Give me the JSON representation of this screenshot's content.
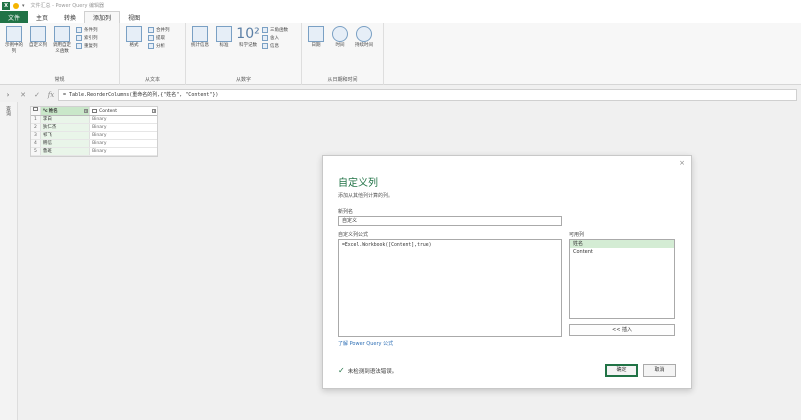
{
  "window": {
    "app_logo": "X",
    "title": "文件汇总 - Power Query 编辑器"
  },
  "ribbon_tabs": [
    {
      "label": "文件"
    },
    {
      "label": "主页"
    },
    {
      "label": "转换"
    },
    {
      "label": "添加列"
    },
    {
      "label": "视图"
    }
  ],
  "ribbon": {
    "group_general": {
      "label": "常规",
      "btn1": "示例中的列",
      "btn2": "自定义列",
      "btn3": "调用自定义函数",
      "small1": "条件列",
      "small2": "索引列",
      "small3": "重复列"
    },
    "group_text": {
      "label": "从文本",
      "btn1": "格式",
      "small1": "合并列",
      "small2": "提取",
      "small3": "分析"
    },
    "group_number": {
      "label": "从数字",
      "btn1": "统计信息",
      "btn2": "标准",
      "btn3": "科学记数",
      "big_text": "10²",
      "small1": "三角函数",
      "small2": "舍入",
      "small3": "信息"
    },
    "group_date": {
      "label": "从日期和时间",
      "btn1": "日期",
      "btn2": "时间",
      "btn3": "持续时间"
    }
  },
  "formula_bar": {
    "formula": "= Table.ReorderColumns(重命名的列,{\"姓名\", \"Content\"})"
  },
  "queries_label": "查询",
  "grid": {
    "headers": {
      "name": "姓名",
      "content": "Content"
    },
    "rows": [
      {
        "idx": "1",
        "name": "李白",
        "content": "Binary"
      },
      {
        "idx": "2",
        "name": "狄仁杰",
        "content": "Binary"
      },
      {
        "idx": "3",
        "name": "祁飞",
        "content": "Binary"
      },
      {
        "idx": "4",
        "name": "韩信",
        "content": "Binary"
      },
      {
        "idx": "5",
        "name": "鲁班",
        "content": "Binary"
      }
    ]
  },
  "dialog": {
    "close": "×",
    "title": "自定义列",
    "description": "添加从其他列计算的列。",
    "new_column_label": "新列名",
    "new_column_value": "自定义",
    "formula_label": "自定义列公式",
    "formula_value": "=Excel.Workbook([Content],true)",
    "available_label": "可用列",
    "available_columns": [
      "姓名",
      "Content"
    ],
    "insert_button": "<< 插入",
    "learn_link": "了解 Power Query 公式",
    "status_text": "未检测到语法错误。",
    "ok_button": "确定",
    "cancel_button": "取消"
  }
}
